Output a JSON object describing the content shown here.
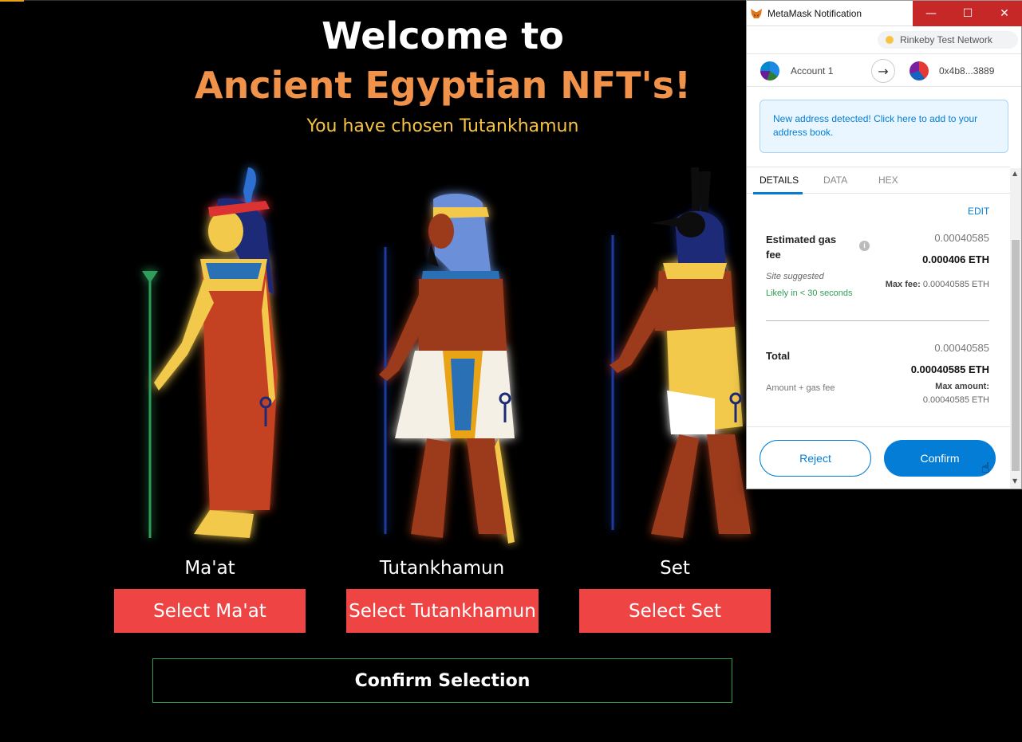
{
  "app": {
    "welcome_title": "Welcome to",
    "subtitle": "Ancient Egyptian NFT's!",
    "chosen_text": "You have chosen Tutankhamun",
    "gods": [
      {
        "name": "Ma'at",
        "button": "Select Ma'at",
        "glow": "#f6c343"
      },
      {
        "name": "Tutankhamun",
        "button": "Select Tutankhamun",
        "glow": "#22c55e"
      },
      {
        "name": "Set",
        "button": "Select Set",
        "glow": "#ef4444"
      }
    ],
    "confirm_selection": "Confirm Selection",
    "colors": {
      "accent": "#ef4444",
      "title_orange": "#f0924a",
      "chosen_yellow": "#f6c343",
      "confirm_border": "#2f9e55"
    }
  },
  "metamask": {
    "window_title": "MetaMask Notification",
    "window_buttons": {
      "minimize": "—",
      "maximize": "☐",
      "close": "✕"
    },
    "network": "Rinkeby Test Network",
    "from_account": "Account 1",
    "to_address": "0x4b8...3889",
    "notice": "New address detected! Click here to add to your address book.",
    "tabs": [
      "DETAILS",
      "DATA",
      "HEX"
    ],
    "edit": "EDIT",
    "gas": {
      "label": "Estimated gas fee",
      "secondary": "0.00040585",
      "primary": "0.000406 ETH",
      "site_suggested": "Site suggested",
      "likely": "Likely in < 30 seconds",
      "max_fee_label": "Max fee:",
      "max_fee_value": "0.00040585 ETH"
    },
    "total": {
      "label": "Total",
      "secondary": "0.00040585",
      "primary": "0.00040585 ETH",
      "amount_gas": "Amount + gas fee",
      "max_amount_label": "Max amount:",
      "max_amount_value": "0.00040585 ETH"
    },
    "buttons": {
      "reject": "Reject",
      "confirm": "Confirm"
    },
    "colors": {
      "primary_blue": "#037dd6",
      "likely_green": "#2f9e55",
      "titlebar_red": "#c62828"
    }
  }
}
